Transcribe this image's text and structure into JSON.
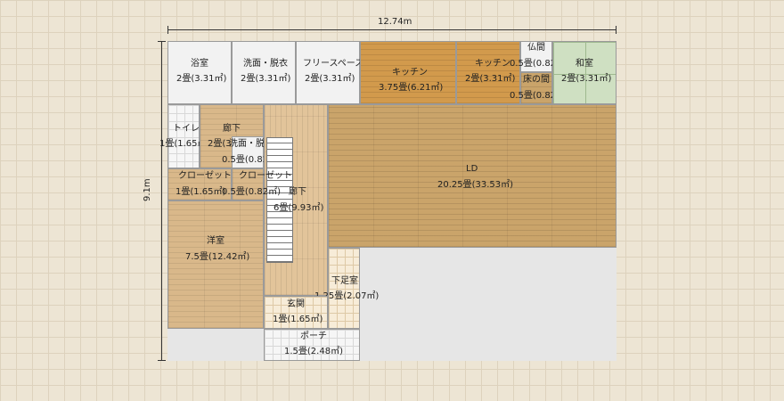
{
  "dimensions": {
    "width": "12.74m",
    "height": "9.1m"
  },
  "rooms": {
    "bath": {
      "name": "浴室",
      "area": "2畳(3.31㎡)"
    },
    "wash1": {
      "name": "洗面・脱衣",
      "area": "2畳(3.31㎡)"
    },
    "free": {
      "name": "フリースペース",
      "area": "2畳(3.31㎡)"
    },
    "kitchen1": {
      "name": "キッチン",
      "area": "3.75畳(6.21㎡)"
    },
    "kitchen2": {
      "name": "キッチン",
      "area": "2畳(3.31㎡)"
    },
    "butsuma": {
      "name": "仏間",
      "area": "0.5畳(0.82㎡)"
    },
    "tokonoma": {
      "name": "床の間",
      "area": "0.5畳(0.82㎡)"
    },
    "washitsu": {
      "name": "和室",
      "area": "2畳(3.31㎡)"
    },
    "toilet": {
      "name": "トイレ",
      "area": "1畳(1.65㎡)"
    },
    "corridor1": {
      "name": "廊下",
      "area": "2畳(3.31㎡)"
    },
    "wash2": {
      "name": "洗面・脱衣",
      "area": "0.5畳(0.82㎡)"
    },
    "closet1": {
      "name": "クローゼット",
      "area": "1畳(1.65㎡)"
    },
    "closet2": {
      "name": "クローゼット",
      "area": "0.5畳(0.82㎡)"
    },
    "corridor2": {
      "name": "廊下",
      "area": "6畳(9.93㎡)"
    },
    "ld": {
      "name": "LD",
      "area": "20.25畳(33.53㎡)"
    },
    "western": {
      "name": "洋室",
      "area": "7.5畳(12.42㎡)"
    },
    "shoes": {
      "name": "下足室",
      "area": "1.25畳(2.07㎡)"
    },
    "entrance": {
      "name": "玄関",
      "area": "1畳(1.65㎡)"
    },
    "porch": {
      "name": "ポーチ",
      "area": "1.5畳(2.48㎡)"
    }
  }
}
